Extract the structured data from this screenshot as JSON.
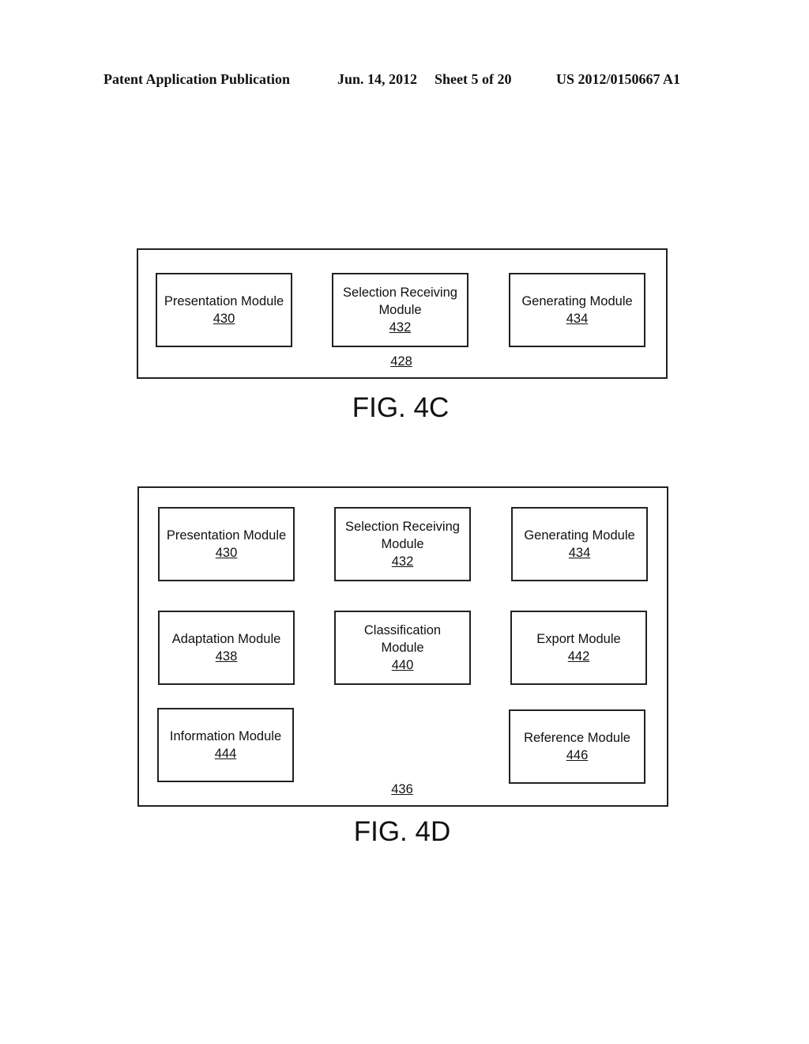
{
  "header": {
    "left": "Patent Application Publication",
    "date": "Jun. 14, 2012",
    "sheet": "Sheet 5 of 20",
    "number": "US 2012/0150667 A1"
  },
  "fig4c": {
    "container_ref": "428",
    "caption": "FIG. 4C",
    "modules": [
      {
        "lines": [
          "Presentation Module"
        ],
        "ref": "430"
      },
      {
        "lines": [
          "Selection Receiving",
          "Module"
        ],
        "ref": "432"
      },
      {
        "lines": [
          "Generating Module"
        ],
        "ref": "434"
      }
    ]
  },
  "fig4d": {
    "container_ref": "436",
    "caption": "FIG. 4D",
    "modules": [
      {
        "lines": [
          "Presentation Module"
        ],
        "ref": "430"
      },
      {
        "lines": [
          "Selection Receiving",
          "Module"
        ],
        "ref": "432"
      },
      {
        "lines": [
          "Generating Module"
        ],
        "ref": "434"
      },
      {
        "lines": [
          "Adaptation Module"
        ],
        "ref": "438"
      },
      {
        "lines": [
          "Classification",
          "Module"
        ],
        "ref": "440"
      },
      {
        "lines": [
          "Export Module"
        ],
        "ref": "442"
      },
      {
        "lines": [
          "Information Module"
        ],
        "ref": "444"
      },
      {
        "lines": [
          "Reference Module"
        ],
        "ref": "446"
      }
    ]
  }
}
